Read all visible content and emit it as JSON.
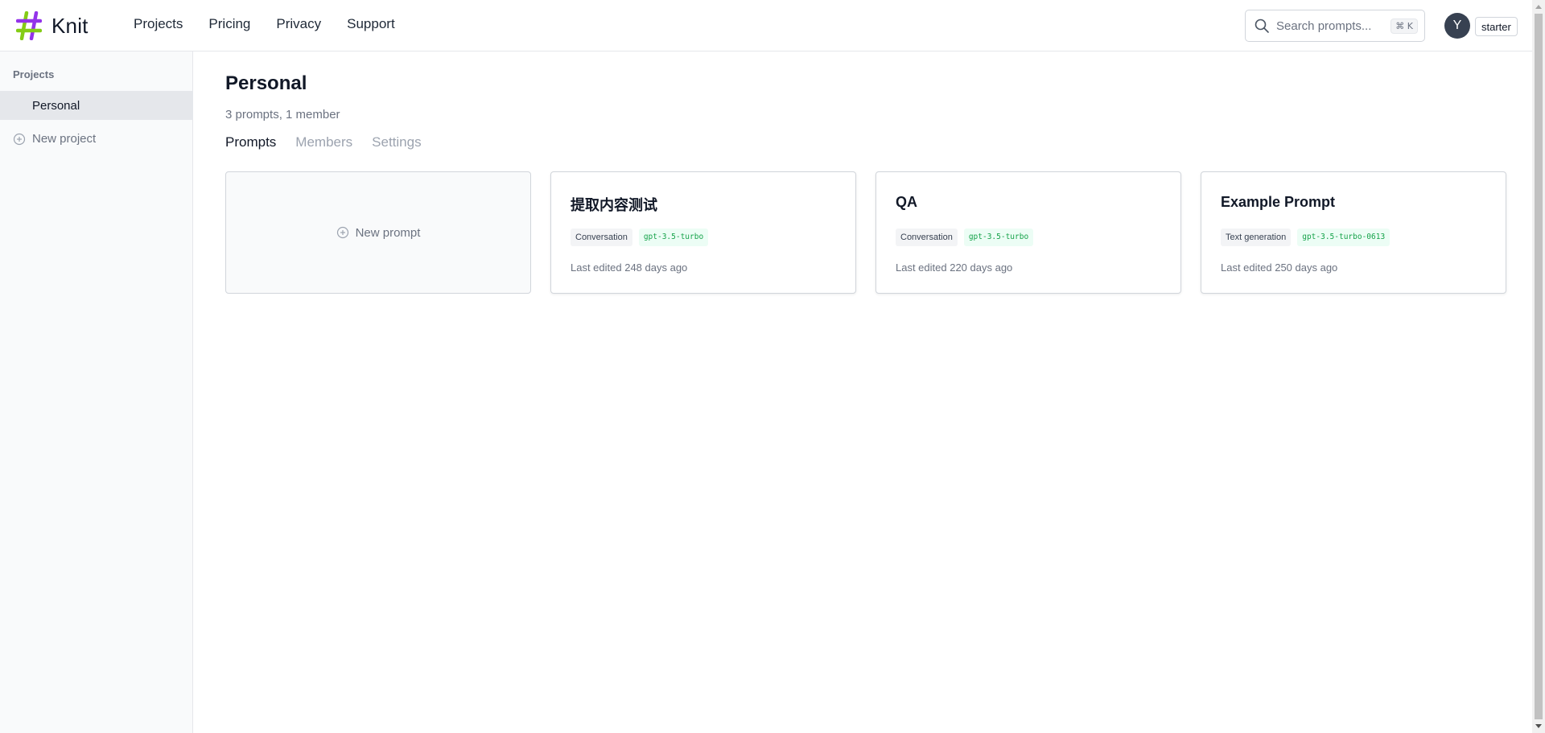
{
  "brand": {
    "name": "Knit"
  },
  "nav": {
    "items": [
      {
        "label": "Projects"
      },
      {
        "label": "Pricing"
      },
      {
        "label": "Privacy"
      },
      {
        "label": "Support"
      }
    ]
  },
  "search": {
    "placeholder": "Search prompts...",
    "shortcut": "⌘ K"
  },
  "user": {
    "initial": "Y",
    "plan": "starter"
  },
  "sidebar": {
    "title": "Projects",
    "items": [
      {
        "label": "Personal",
        "active": true
      }
    ],
    "new_project_label": "New project"
  },
  "main": {
    "title": "Personal",
    "subtitle": "3 prompts, 1 member",
    "tabs": [
      {
        "label": "Prompts",
        "active": true
      },
      {
        "label": "Members",
        "active": false
      },
      {
        "label": "Settings",
        "active": false
      }
    ],
    "new_prompt_label": "New prompt",
    "prompts": [
      {
        "title": "提取内容测试",
        "type": "Conversation",
        "model": "gpt-3.5-turbo",
        "edited": "Last edited 248 days ago"
      },
      {
        "title": "QA",
        "type": "Conversation",
        "model": "gpt-3.5-turbo",
        "edited": "Last edited 220 days ago"
      },
      {
        "title": "Example Prompt",
        "type": "Text generation",
        "model": "gpt-3.5-turbo-0613",
        "edited": "Last edited 250 days ago"
      }
    ]
  },
  "colors": {
    "logo_green": "#84cc16",
    "logo_purple": "#9333ea",
    "model_tag_text": "#16a34a",
    "model_tag_bg": "#ecfdf5"
  }
}
